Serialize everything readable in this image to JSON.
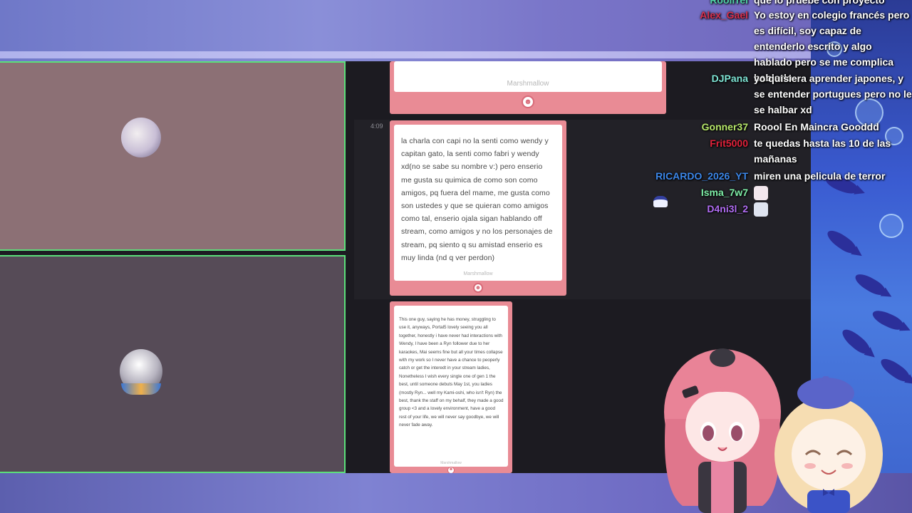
{
  "stream": {
    "cam_panels": [
      "top",
      "bottom"
    ]
  },
  "cards": [
    {
      "brand": "Marshmallow"
    },
    {
      "time": "4:09",
      "text": "la charla con capi no la senti como wendy y capitan gato, la senti como fabri y wendy xd(no se sabe su nombre v:) pero enserio me gusta su quimica de como son como amigos, pq fuera del mame, me gusta como son ustedes y que se quieran como amigos como tal, enserio ojala sigan hablando off stream, como amigos y no los personajes de stream, pq siento q su amistad enserio es muy linda (nd q ver perdon)",
      "brand": "Marshmallow"
    },
    {
      "text": "This one guy, saying he has money, struggling to use it, anyways, Portal5 lovely seeing you all together, honestly i have never had interactions with Wendy, I have been a Ryn follower due to her karaokes, Mai seems fine but all your times collapse with my work so I never have a chance to peoperly catch or get the interedt in your stream ladies, Nonetheless I wish every single one of gen 1 the best, until someone debuts May 1st, you ladies (mostly Ryn... well my Kami-oshi, who isn't Ryn) the best, thank the staff on my behalf, they made a good group <3 and a lovely environment, have a good rest of your life, we will never say goodbye, we will never fade away.",
      "brand": "Marshmallow"
    }
  ],
  "chat": [
    {
      "user": "Rooirrel",
      "color": "#4fd1a5",
      "text": "que lo pruebe con proyecto"
    },
    {
      "user": "Alex_Gael",
      "color": "#d6304e",
      "text": "Yo estoy en colegio francés pero es difícil, soy capaz de entenderlo escrito y algo hablado pero se me complica hablarlo"
    },
    {
      "user": "DJPana",
      "color": "#7fe6d6",
      "text": "yo quisiera aprender japones, y se entender portugues pero no le se halbar xd"
    },
    {
      "user": "Gonner37",
      "color": "#b7e86a",
      "text": "Roool En Maincra Gooddd"
    },
    {
      "user": "Frit5000",
      "color": "#e0213a",
      "text": "te quedas hasta las 10 de las mañanas"
    },
    {
      "user": "RICARDO_2026_YT",
      "color": "#3b86e8",
      "text": "miren una pelicula de terror"
    },
    {
      "user": "Isma_7w7",
      "color": "#7ff0a8",
      "text": ""
    },
    {
      "user": "D4ni3l_2",
      "color": "#b06cf2",
      "text": ""
    }
  ]
}
